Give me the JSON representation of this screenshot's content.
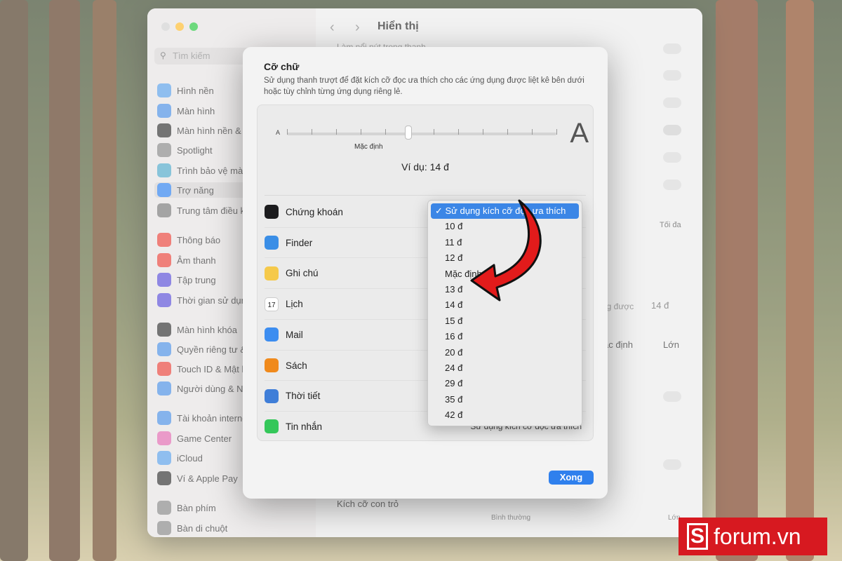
{
  "colors": {
    "accent": "#3b86e6",
    "button": "#2f80ed",
    "brand": "#d71920",
    "arrow": "#e21b1b"
  },
  "sidebar": {
    "search_placeholder": "Tìm kiếm",
    "items": [
      {
        "label": "Hình nền",
        "icon": "wallpaper-icon",
        "color": "#5aa0e8"
      },
      {
        "label": "Màn hình",
        "icon": "display-icon",
        "color": "#4c8fe3"
      },
      {
        "label": "Màn hình nền & Dock",
        "icon": "dock-icon",
        "color": "#333333"
      },
      {
        "label": "Spotlight",
        "icon": "spotlight-icon",
        "color": "#888888"
      },
      {
        "label": "Trình bảo vệ màn hình",
        "icon": "screensaver-icon",
        "color": "#50a9c9"
      },
      {
        "label": "Trợ năng",
        "icon": "accessibility-icon",
        "color": "#2f80ed",
        "selected": true
      },
      {
        "label": "Trung tâm điều khiển",
        "icon": "control-center-icon",
        "color": "#7a7a7a"
      },
      {
        "label": "Thông báo",
        "icon": "notifications-icon",
        "color": "#e8453c"
      },
      {
        "label": "Âm thanh",
        "icon": "sound-icon",
        "color": "#e8453c"
      },
      {
        "label": "Tập trung",
        "icon": "focus-icon",
        "color": "#5b4fd6"
      },
      {
        "label": "Thời gian sử dụng",
        "icon": "screen-time-icon",
        "color": "#5b4fd6"
      },
      {
        "label": "Màn hình khóa",
        "icon": "lock-screen-icon",
        "color": "#333333"
      },
      {
        "label": "Quyền riêng tư & Bảo mật",
        "icon": "privacy-icon",
        "color": "#4c8fe3"
      },
      {
        "label": "Touch ID & Mật khẩu",
        "icon": "touch-id-icon",
        "color": "#e8453c"
      },
      {
        "label": "Người dùng & Nhóm",
        "icon": "users-icon",
        "color": "#4c8fe3"
      },
      {
        "label": "Tài khoản internet",
        "icon": "internet-accounts-icon",
        "color": "#4c8fe3"
      },
      {
        "label": "Game Center",
        "icon": "game-center-icon",
        "color": "#e06bb0"
      },
      {
        "label": "iCloud",
        "icon": "icloud-icon",
        "color": "#5aa0e8"
      },
      {
        "label": "Ví & Apple Pay",
        "icon": "wallet-icon",
        "color": "#333333"
      },
      {
        "label": "Bàn phím",
        "icon": "keyboard-icon",
        "color": "#888888"
      },
      {
        "label": "Bàn di chuột",
        "icon": "trackpad-icon",
        "color": "#888888"
      }
    ]
  },
  "main": {
    "title": "Hiển thị",
    "partial_text": "Làm nổi nút trong thanh",
    "slider_max": "Tối đa",
    "size_label": "ng được",
    "size_value": "14 đ",
    "radio_default": "ặc định",
    "radio_large": "Lớn",
    "pointer_size": "Kích cỡ con trỏ",
    "pointer_normal": "Bình thường",
    "pointer_large": "Lớn"
  },
  "dialog": {
    "title": "Cỡ chữ",
    "description": "Sử dụng thanh trượt để đặt kích cỡ đọc ưa thích cho các ứng dụng được liệt kê bên dưới hoặc tùy chỉnh từng ứng dụng riêng lẻ.",
    "slider_small": "A",
    "slider_large": "A",
    "slider_default_label": "Mặc định",
    "slider_level": 0.45,
    "example": "Ví dụ: 14 đ",
    "apps": [
      {
        "name": "Chứng khoán",
        "icon": "stocks-icon",
        "color": "#1c1c1e"
      },
      {
        "name": "Finder",
        "icon": "finder-icon",
        "color": "#3a8ee6"
      },
      {
        "name": "Ghi chú",
        "icon": "notes-icon",
        "color": "#f5c94a"
      },
      {
        "name": "Lịch",
        "icon": "calendar-icon",
        "color": "#ffffff",
        "label": "17"
      },
      {
        "name": "Mail",
        "icon": "mail-icon",
        "color": "#3c8df0"
      },
      {
        "name": "Sách",
        "icon": "books-icon",
        "color": "#f08a1c"
      },
      {
        "name": "Thời tiết",
        "icon": "weather-icon",
        "color": "#3f7ed8"
      },
      {
        "name": "Tin nhắn",
        "icon": "messages-icon",
        "color": "#34c759",
        "picker": "Sử dụng kích cỡ đọc ưa thích"
      }
    ],
    "done": "Xong"
  },
  "menu": {
    "items": [
      "✓ Sử dụng kích cỡ đọc ưa thích",
      "10 đ",
      "11 đ",
      "12 đ",
      "Mặc định",
      "13 đ",
      "14 đ",
      "15 đ",
      "16 đ",
      "20 đ",
      "24 đ",
      "29 đ",
      "35 đ",
      "42 đ"
    ],
    "highlighted_index": 0
  },
  "watermark": {
    "text": "forum.vn",
    "mark": "S"
  }
}
